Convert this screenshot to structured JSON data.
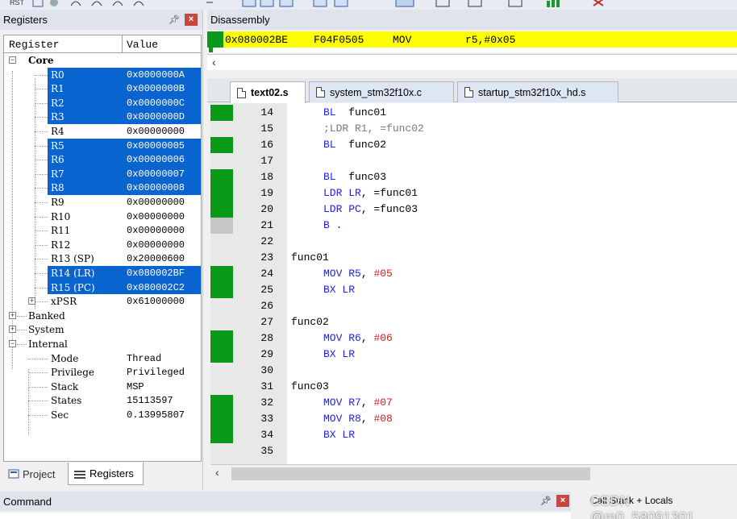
{
  "registers": {
    "title": "Registers",
    "col_register": "Register",
    "col_value": "Value",
    "groups": {
      "core": "Core",
      "banked": "Banked",
      "system": "System",
      "internal": "Internal"
    },
    "core": [
      {
        "name": "R0",
        "value": "0x0000000A"
      },
      {
        "name": "R1",
        "value": "0x0000000B"
      },
      {
        "name": "R2",
        "value": "0x0000000C"
      },
      {
        "name": "R3",
        "value": "0x0000000D"
      },
      {
        "name": "R4",
        "value": "0x00000000"
      },
      {
        "name": "R5",
        "value": "0x00000005"
      },
      {
        "name": "R6",
        "value": "0x00000006"
      },
      {
        "name": "R7",
        "value": "0x00000007"
      },
      {
        "name": "R8",
        "value": "0x00000008"
      },
      {
        "name": "R9",
        "value": "0x00000000"
      },
      {
        "name": "R10",
        "value": "0x00000000"
      },
      {
        "name": "R11",
        "value": "0x00000000"
      },
      {
        "name": "R12",
        "value": "0x00000000"
      },
      {
        "name": "R13 (SP)",
        "value": "0x20000600"
      },
      {
        "name": "R14 (LR)",
        "value": "0x080002BF"
      },
      {
        "name": "R15 (PC)",
        "value": "0x080002C2"
      },
      {
        "name": "xPSR",
        "value": "0x61000000"
      }
    ],
    "internal": [
      {
        "name": "Mode",
        "value": "Thread"
      },
      {
        "name": "Privilege",
        "value": "Privileged"
      },
      {
        "name": "Stack",
        "value": "MSP"
      },
      {
        "name": "States",
        "value": "15113597"
      },
      {
        "name": "Sec",
        "value": "0.13995807"
      }
    ],
    "tabs": {
      "project": "Project",
      "registers": "Registers"
    }
  },
  "disassembly": {
    "title": "Disassembly",
    "address": "0x080002BE",
    "opcode": "F04F0505",
    "mnemonic": "MOV",
    "operands": "r5,#0x05"
  },
  "editor": {
    "tabs": [
      "text02.s",
      "system_stm32f10x.c",
      "startup_stm32f10x_hd.s"
    ],
    "lines": [
      {
        "n": "14",
        "code": "BL  func01"
      },
      {
        "n": "15",
        "code": ";LDR R1, =func02"
      },
      {
        "n": "16",
        "code": "BL  func02"
      },
      {
        "n": "17",
        "code": ""
      },
      {
        "n": "18",
        "code": "BL  func03"
      },
      {
        "n": "19",
        "code": "LDR LR, =func01"
      },
      {
        "n": "20",
        "code": "LDR PC, =func03"
      },
      {
        "n": "21",
        "code": "B ."
      },
      {
        "n": "22",
        "code": ""
      },
      {
        "n": "23",
        "code": "func01"
      },
      {
        "n": "24",
        "code": "MOV R5, #05"
      },
      {
        "n": "25",
        "code": "BX LR"
      },
      {
        "n": "26",
        "code": ""
      },
      {
        "n": "27",
        "code": "func02"
      },
      {
        "n": "28",
        "code": "MOV R6, #06"
      },
      {
        "n": "29",
        "code": "BX LR"
      },
      {
        "n": "30",
        "code": ""
      },
      {
        "n": "31",
        "code": "func03"
      },
      {
        "n": "32",
        "code": "MOV R7, #07"
      },
      {
        "n": "33",
        "code": "MOV R8, #08"
      },
      {
        "n": "34",
        "code": "BX LR"
      },
      {
        "n": "35",
        "code": ""
      }
    ]
  },
  "command": {
    "title": "Command"
  },
  "callstack": {
    "title": "Call Stack + Locals"
  },
  "watermark": "CSDN @m0_58091301",
  "colors": {
    "selection": "#0a64d0",
    "exec_marker": "#0a9a1a",
    "current_line": "#ffff00",
    "keyword": "#1e1ee6",
    "immediate": "#c81e1e"
  }
}
